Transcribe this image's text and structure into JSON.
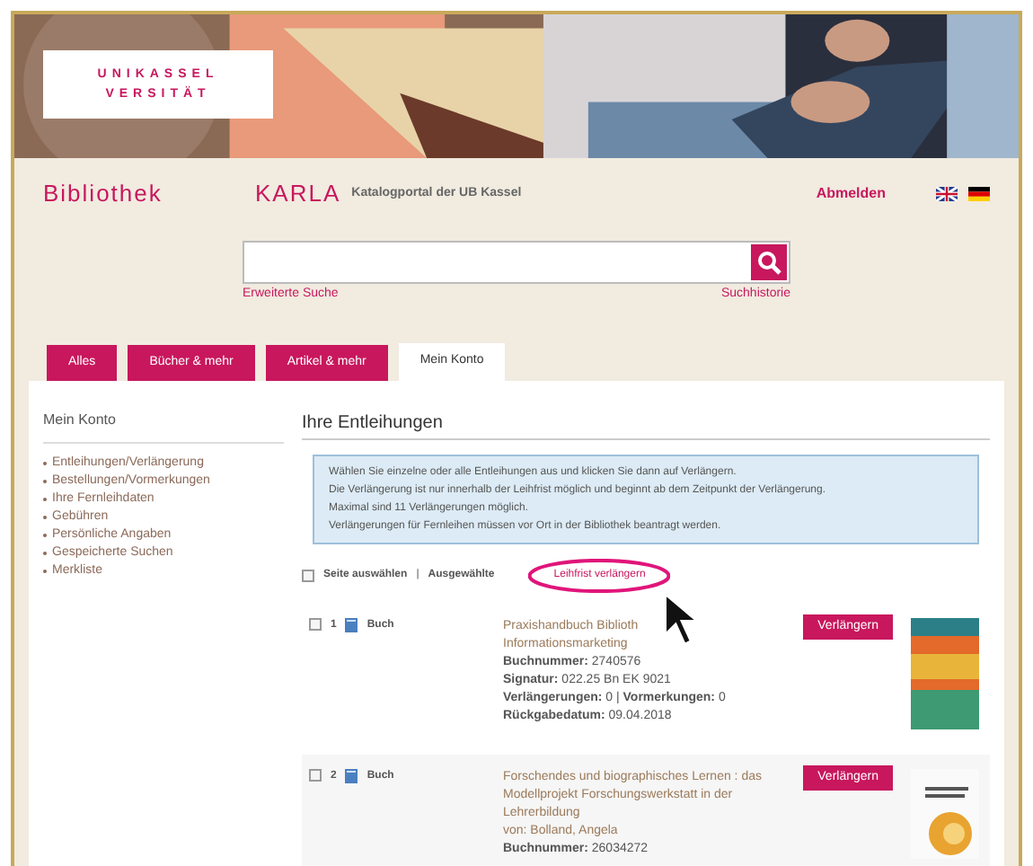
{
  "logo": {
    "line1": "UNIKASSEL",
    "line2": "VERSITÄT"
  },
  "header": {
    "site": "Bibliothek",
    "brand": "KARLA",
    "tagline": "Katalogportal der UB Kassel",
    "logout": "Abmelden"
  },
  "search": {
    "advanced": "Erweiterte Suche",
    "history": "Suchhistorie"
  },
  "tabs": [
    {
      "label": "Alles",
      "selected": false
    },
    {
      "label": "Bücher & mehr",
      "selected": false
    },
    {
      "label": "Artikel & mehr",
      "selected": false
    },
    {
      "label": "Mein Konto",
      "selected": true
    }
  ],
  "sidebar": {
    "title": "Mein Konto",
    "items": [
      "Entleihungen/Verlängerung",
      "Bestellungen/Vormerkungen",
      "Ihre Fernleihdaten",
      "Gebühren",
      "Persönliche Angaben",
      "Gespeicherte Suchen",
      "Merkliste"
    ]
  },
  "main": {
    "title": "Ihre Entleihungen",
    "notice": [
      "Wählen Sie einzelne oder alle Entleihungen aus und klicken Sie dann auf Verlängern.",
      "Die Verlängerung ist nur innerhalb der Leihfrist möglich und beginnt ab dem Zeitpunkt der Verlängerung.",
      "Maximal sind 11 Verlängerungen möglich.",
      "Verlängerungen für Fernleihen müssen vor Ort in der Bibliothek beantragt werden."
    ],
    "select_page": {
      "label": "Seite auswählen",
      "checked": false
    },
    "separator": "|",
    "selected_action": "Ausgewählte",
    "extend_action": "Leihfrist verlängern",
    "loans": [
      {
        "checked": false,
        "number": "1",
        "type": "Buch",
        "title": [
          "Praxishandbuch Biblioth",
          "Informationsmarketing"
        ],
        "fields": [
          [
            "**Buchnummer:** 2740576"
          ],
          [
            "**Signatur:** 022.25 Bn EK 9021"
          ],
          [
            "**Verlängerungen:** 0 | **Vormerkungen:** 0"
          ],
          [
            "**Rückgabedatum:** 09.04.2018"
          ]
        ],
        "button": "Verlängern"
      },
      {
        "checked": false,
        "number": "2",
        "type": "Buch",
        "title": [
          "Forschendes und biographisches Lernen : das",
          "Modellprojekt Forschungswerkstatt in der",
          "Lehrerbildung"
        ],
        "author": "von: Bolland, Angela",
        "fields": [
          [
            "**Buchnummer:** 26034272"
          ]
        ],
        "button": "Verlängern"
      }
    ]
  }
}
